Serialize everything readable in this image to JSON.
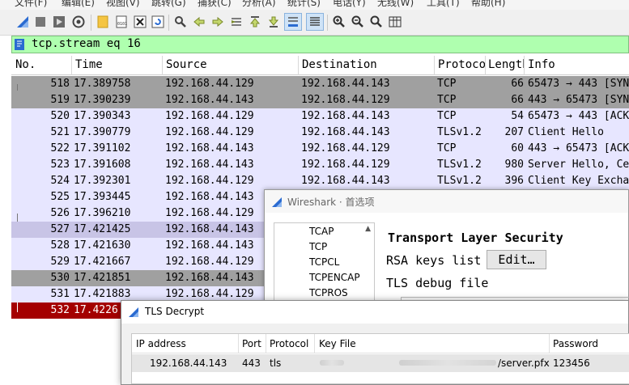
{
  "menu": [
    "文件(F)",
    "编辑(E)",
    "视图(V)",
    "跳转(G)",
    "捕获(C)",
    "分析(A)",
    "统计(S)",
    "电话(Y)",
    "无线(W)",
    "工具(T)",
    "帮助(H)"
  ],
  "toolbar_icons": [
    "shark-fin-start-icon",
    "stop-icon",
    "restart-icon",
    "options-gear-icon",
    "open-file-icon",
    "file-set-icon",
    "close-file-icon",
    "reload-icon",
    "find-icon",
    "back-icon",
    "forward-icon",
    "go-to-packet-icon",
    "first-packet-icon",
    "last-packet-icon",
    "auto-scroll-icon",
    "colorize-icon",
    "zoom-in-icon",
    "zoom-out-icon",
    "normal-size-icon",
    "resize-columns-icon"
  ],
  "filter": {
    "text": "tcp.stream eq 16"
  },
  "packet_list": {
    "columns": [
      "No.",
      "Time",
      "Source",
      "Destination",
      "Protocol",
      "Length",
      "Info"
    ],
    "rows": [
      {
        "no": "518",
        "time": "17.389758",
        "src": "192.168.44.129",
        "dst": "192.168.44.143",
        "proto": "TCP",
        "len": "66",
        "info": "65473 → 443 [SYN]"
      },
      {
        "no": "519",
        "time": "17.390239",
        "src": "192.168.44.143",
        "dst": "192.168.44.129",
        "proto": "TCP",
        "len": "66",
        "info": "443 → 65473 [SYN"
      },
      {
        "no": "520",
        "time": "17.390343",
        "src": "192.168.44.129",
        "dst": "192.168.44.143",
        "proto": "TCP",
        "len": "54",
        "info": "65473 → 443 [ACK]"
      },
      {
        "no": "521",
        "time": "17.390779",
        "src": "192.168.44.129",
        "dst": "192.168.44.143",
        "proto": "TLSv1.2",
        "len": "207",
        "info": "Client Hello"
      },
      {
        "no": "522",
        "time": "17.391102",
        "src": "192.168.44.143",
        "dst": "192.168.44.129",
        "proto": "TCP",
        "len": "60",
        "info": "443 → 65473 [ACK"
      },
      {
        "no": "523",
        "time": "17.391608",
        "src": "192.168.44.143",
        "dst": "192.168.44.129",
        "proto": "TLSv1.2",
        "len": "980",
        "info": "Server Hello, Ce"
      },
      {
        "no": "524",
        "time": "17.392301",
        "src": "192.168.44.129",
        "dst": "192.168.44.143",
        "proto": "TLSv1.2",
        "len": "396",
        "info": "Client Key Excha"
      },
      {
        "no": "525",
        "time": "17.393445",
        "src": "192.168.44.143",
        "dst": "",
        "proto": "",
        "len": "",
        "info": ""
      },
      {
        "no": "526",
        "time": "17.396210",
        "src": "192.168.44.129",
        "dst": "",
        "proto": "",
        "len": "",
        "info": ""
      },
      {
        "no": "527",
        "time": "17.421425",
        "src": "192.168.44.143",
        "dst": "",
        "proto": "",
        "len": "",
        "info": ""
      },
      {
        "no": "528",
        "time": "17.421630",
        "src": "192.168.44.143",
        "dst": "",
        "proto": "",
        "len": "",
        "info": ""
      },
      {
        "no": "529",
        "time": "17.421667",
        "src": "192.168.44.129",
        "dst": "",
        "proto": "",
        "len": "",
        "info": ""
      },
      {
        "no": "530",
        "time": "17.421851",
        "src": "192.168.44.143",
        "dst": "",
        "proto": "",
        "len": "",
        "info": ""
      },
      {
        "no": "531",
        "time": "17.421883",
        "src": "192.168.44.129",
        "dst": "",
        "proto": "",
        "len": "",
        "info": ""
      },
      {
        "no": "532",
        "time": "17.4226",
        "src": "",
        "dst": "",
        "proto": "",
        "len": "",
        "info": ""
      }
    ],
    "row_colors": [
      "#a0a0a0",
      "#a0a0a0",
      "#e7e6ff",
      "#e7e6ff",
      "#e7e6ff",
      "#e7e6ff",
      "#e7e6ff",
      "#e7e6ff",
      "#e7e6ff",
      "#c8c4e6",
      "#e7e6ff",
      "#e7e6ff",
      "#a0a0a0",
      "#e7e6ff",
      "#a40000"
    ]
  },
  "prefs": {
    "title": "Wireshark · 首选项",
    "tree": [
      "TCAP",
      "TCP",
      "TCPCL",
      "TCPENCAP",
      "TCPROS"
    ],
    "heading": "Transport Layer Security",
    "rsa_label": "RSA keys list",
    "edit_button": "Edit…",
    "debug_label": "TLS debug file"
  },
  "tls": {
    "title": "TLS Decrypt",
    "columns": [
      "IP address",
      "Port",
      "Protocol",
      "Key File",
      "Password"
    ],
    "row": {
      "ip": "192.168.44.143",
      "port": "443",
      "protocol": "tls",
      "keyfile": "/server.pfx",
      "password": "123456"
    }
  },
  "colors": {
    "filter_bg": "#afffaf",
    "tcp_row": "#e7e6ff",
    "syn_row": "#a0a0a0",
    "selected_row": "#a40000"
  }
}
